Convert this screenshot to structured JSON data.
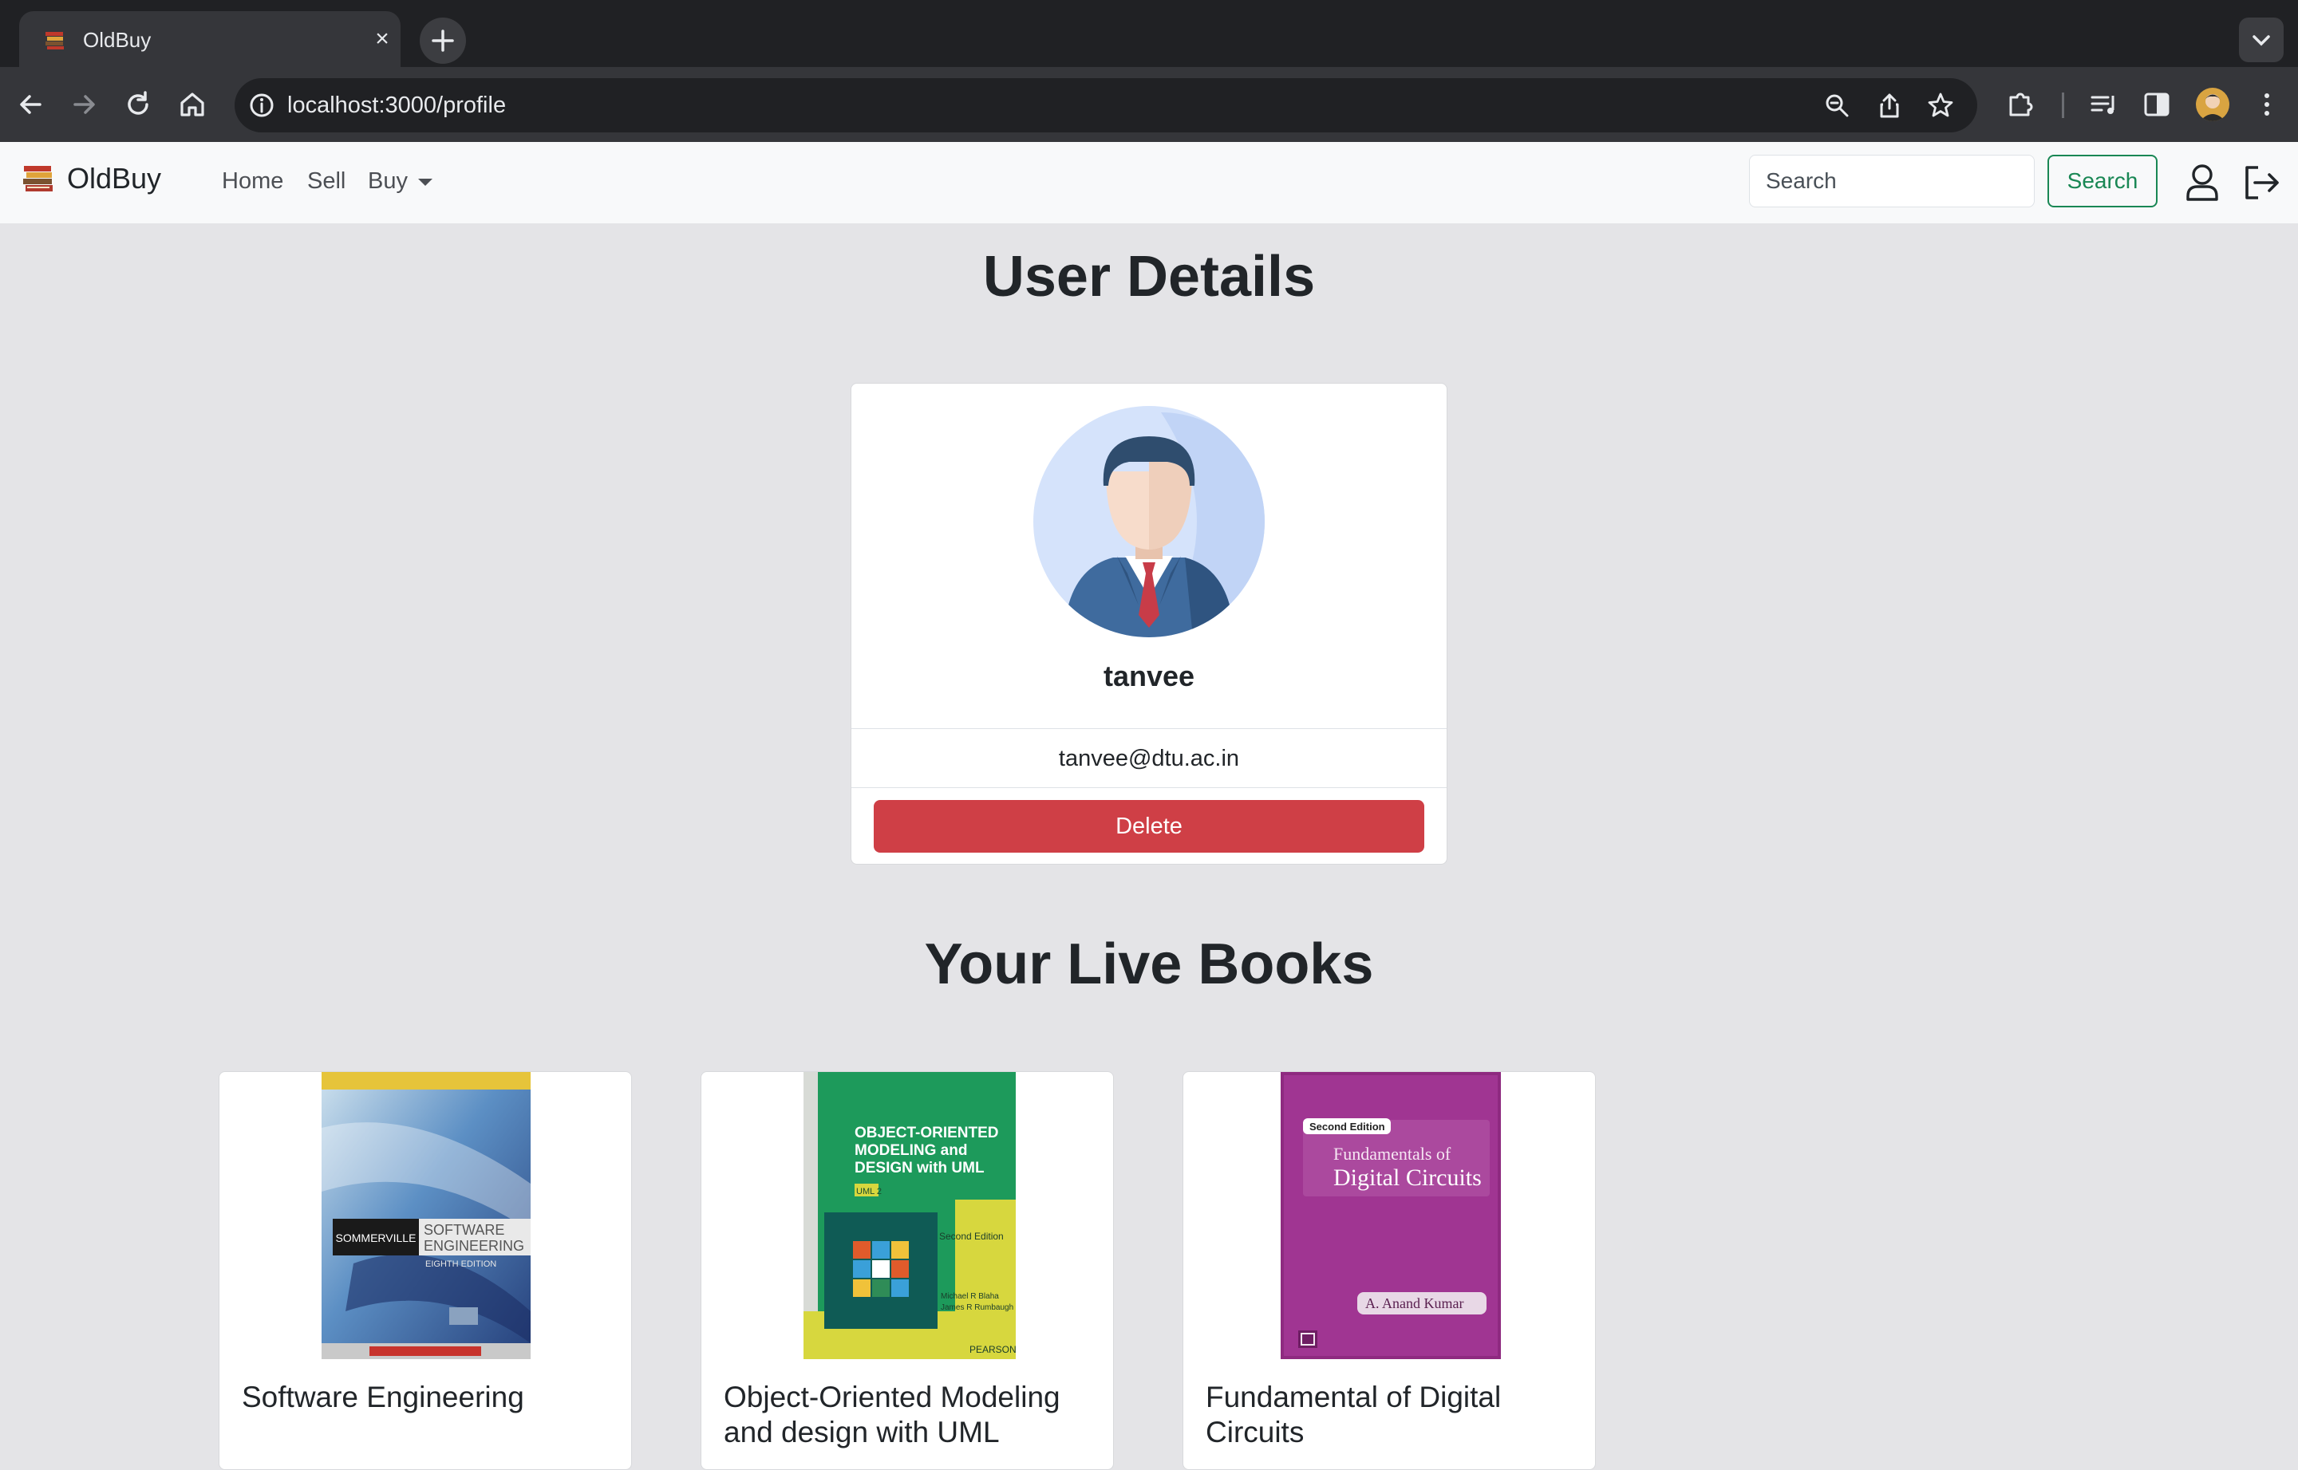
{
  "browser": {
    "tab_title": "OldBuy",
    "url": "localhost:3000/profile"
  },
  "navbar": {
    "brand": "OldBuy",
    "links": [
      "Home",
      "Sell",
      "Buy"
    ],
    "search_placeholder": "Search",
    "search_button": "Search"
  },
  "profile": {
    "heading": "User Details",
    "name": "tanvee",
    "email": "tanvee@dtu.ac.in",
    "delete_label": "Delete"
  },
  "books": {
    "heading": "Your Live Books",
    "items": [
      {
        "title": "Software Engineering",
        "cover": {
          "author": "SOMMERVILLE",
          "line1": "SOFTWARE",
          "line2": "ENGINEERING",
          "edition": "EIGHTH EDITION"
        }
      },
      {
        "title": "Object-Oriented Modeling and design with UML",
        "cover": {
          "line1": "OBJECT-ORIENTED",
          "line2": "MODELING and",
          "line3": "DESIGN with UML",
          "tag": "UML 2",
          "edition": "Second Edition",
          "authors1": "Michael R Blaha",
          "authors2": "James R Rumbaugh",
          "publisher": "PEARSON"
        }
      },
      {
        "title": "Fundamental of Digital Circuits",
        "cover": {
          "edition": "Second Edition",
          "line1": "Fundamentals of",
          "line2": "Digital Circuits",
          "author": "A. Anand Kumar"
        }
      }
    ]
  }
}
